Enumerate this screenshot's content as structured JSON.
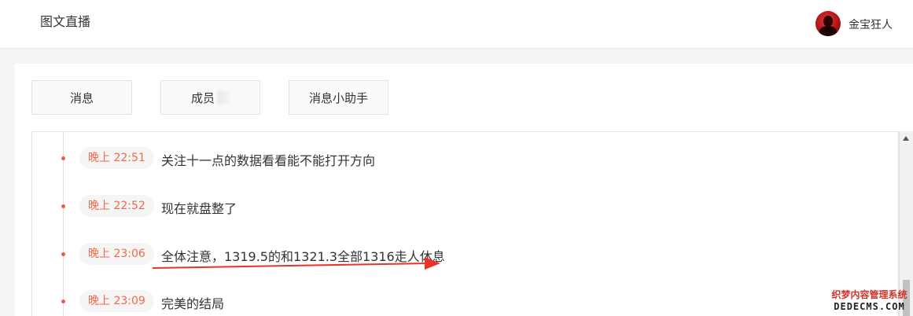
{
  "header": {
    "title": "图文直播",
    "username": "金宝狂人"
  },
  "tabs": [
    {
      "label": "消息"
    },
    {
      "label": "成员"
    },
    {
      "label": "消息小助手"
    }
  ],
  "feed": {
    "items": [
      {
        "time": "晚上 22:51",
        "text": "关注十一点的数据看看能不能打开方向"
      },
      {
        "time": "晚上 22:52",
        "text": "现在就盘整了"
      },
      {
        "time": "晚上 23:06",
        "text": "全体注意，1319.5的和1321.3全部1316走人休息"
      },
      {
        "time": "晚上 23:09",
        "text": "完美的结局"
      }
    ]
  },
  "annotation": {
    "arrow_color": "#e8332a"
  },
  "watermark": {
    "line1": "织梦内容管理系统",
    "line2": "DEDECMS.COM"
  }
}
